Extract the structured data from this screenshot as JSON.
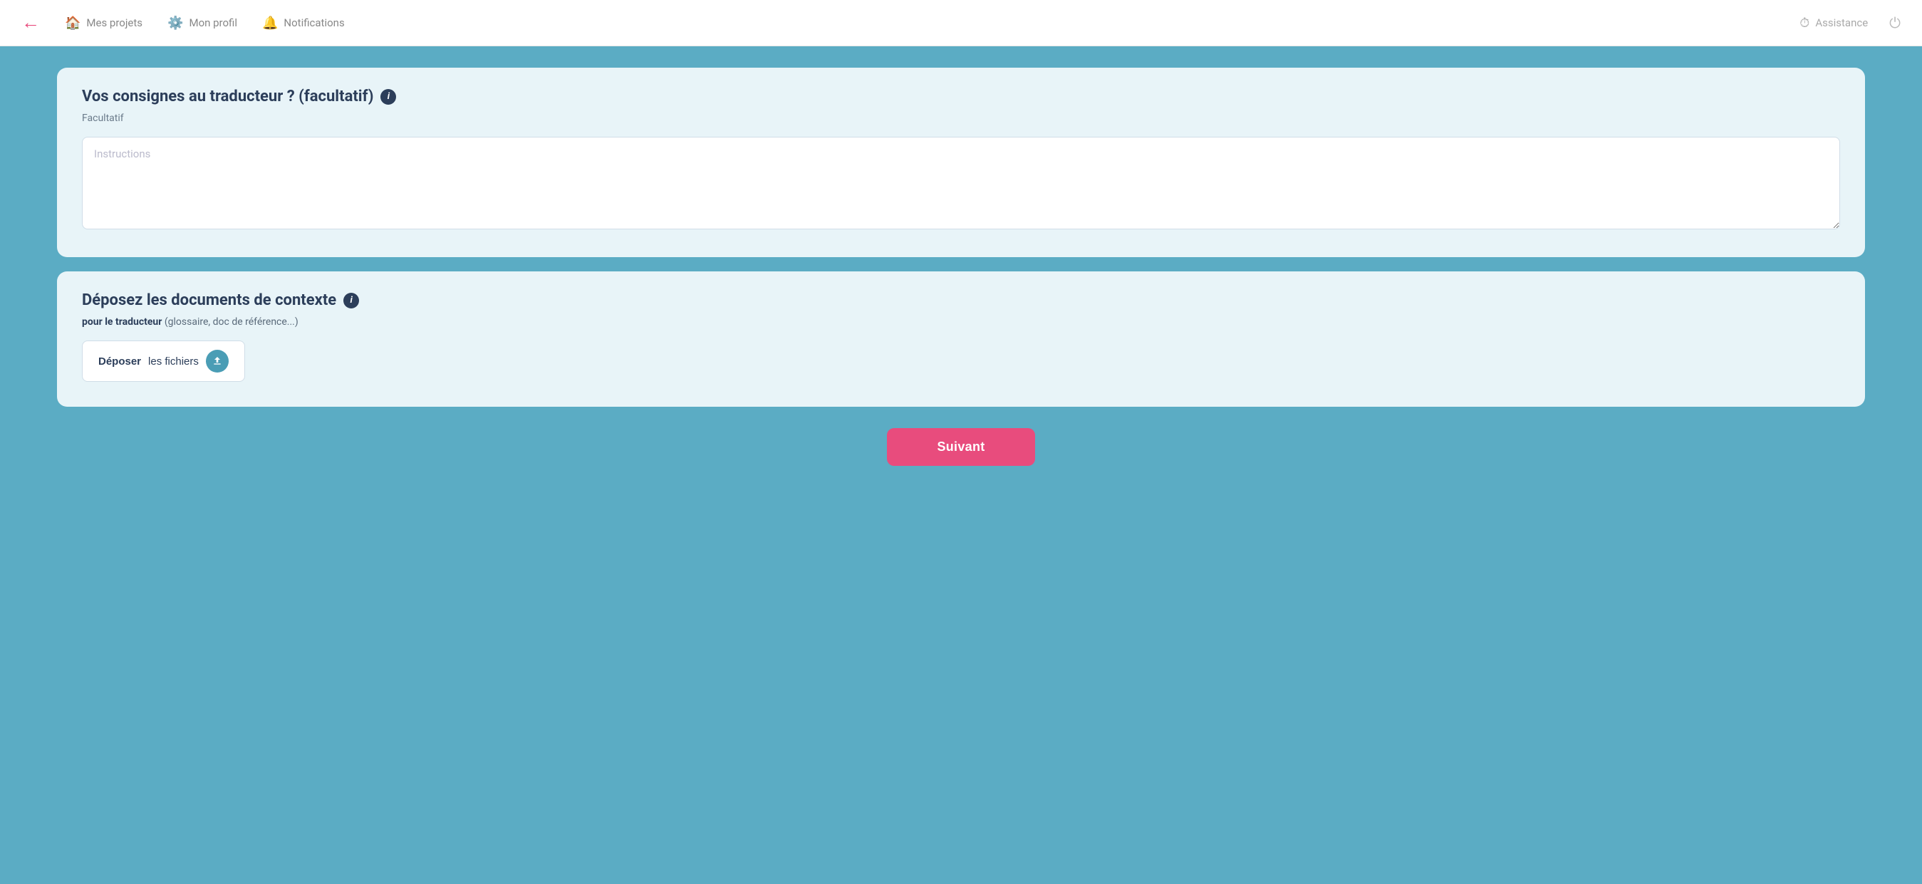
{
  "navbar": {
    "back_label": "←",
    "items": [
      {
        "id": "mes-projets",
        "label": "Mes projets",
        "icon": "🏠"
      },
      {
        "id": "mon-profil",
        "label": "Mon profil",
        "icon": "⚙️"
      },
      {
        "id": "notifications",
        "label": "Notifications",
        "icon": "🔔"
      }
    ],
    "right_items": [
      {
        "id": "assistance",
        "label": "Assistance",
        "icon": "⏱"
      },
      {
        "id": "power",
        "label": "",
        "icon": "⏻"
      }
    ]
  },
  "sections": {
    "instructions": {
      "title": "Vos consignes au traducteur ? (facultatif)",
      "subtitle": "Facultatif",
      "textarea_placeholder": "Instructions"
    },
    "context_docs": {
      "title": "Déposez les documents de contexte",
      "description_bold": "pour le traducteur",
      "description_rest": " (glossaire, doc de référence...)",
      "upload_btn_bold": "Déposer",
      "upload_btn_rest": " les fichiers"
    }
  },
  "next_button": {
    "label": "Suivant"
  }
}
